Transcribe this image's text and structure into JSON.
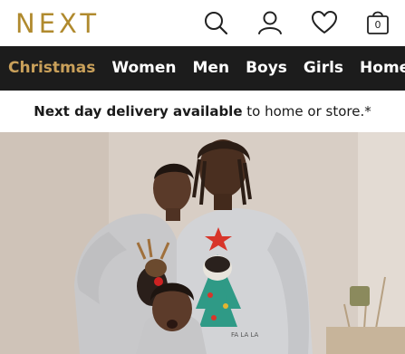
{
  "brand": {
    "logo": "NEXT",
    "accent": "#b08a2e"
  },
  "header": {
    "icons": [
      "search-icon",
      "account-icon",
      "heart-icon",
      "bag-icon"
    ],
    "bag_count": "0"
  },
  "nav": {
    "items": [
      "Christmas",
      "Women",
      "Men",
      "Boys",
      "Girls",
      "Home"
    ],
    "active_color": "#c9a05a",
    "background": "#1c1c1c"
  },
  "promo": {
    "bold": "Next day delivery available",
    "rest": " to home or store.*"
  },
  "hero": {
    "image": "family-christmas-pyjamas-photo",
    "shirt_text": "FA LA LA"
  }
}
